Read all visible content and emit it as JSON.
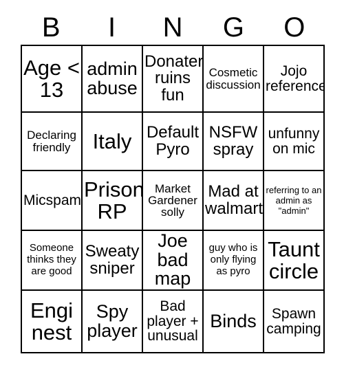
{
  "card": {
    "title": "BINGO",
    "header_letters": [
      "B",
      "I",
      "N",
      "G",
      "O"
    ],
    "columns": 5,
    "rows": 5,
    "border_color": "#000000",
    "background_color": "#ffffff",
    "text_color": "#000000",
    "cells": [
      [
        {
          "text": "Age < 13",
          "size": "fs-xxl"
        },
        {
          "text": "admin abuse",
          "size": "fs-xl"
        },
        {
          "text": "Donater ruins fun",
          "size": "fs-l"
        },
        {
          "text": "Cosmetic discussion",
          "size": "fs-s"
        },
        {
          "text": "Jojo reference",
          "size": "fs-m"
        }
      ],
      [
        {
          "text": "Declaring friendly",
          "size": "fs-s"
        },
        {
          "text": "Italy",
          "size": "fs-xxl"
        },
        {
          "text": "Default Pyro",
          "size": "fs-l"
        },
        {
          "text": "NSFW spray",
          "size": "fs-l"
        },
        {
          "text": "unfunny on mic",
          "size": "fs-m"
        }
      ],
      [
        {
          "text": "Micspam",
          "size": "fs-m"
        },
        {
          "text": "Prison RP",
          "size": "fs-xxl"
        },
        {
          "text": "Market Gardener solly",
          "size": "fs-s"
        },
        {
          "text": "Mad at walmart",
          "size": "fs-l"
        },
        {
          "text": "referring to an admin as \"admin\"",
          "size": "fs-xxs"
        }
      ],
      [
        {
          "text": "Someone thinks they are good",
          "size": "fs-xs"
        },
        {
          "text": "Sweaty sniper",
          "size": "fs-l"
        },
        {
          "text": "Joe bad map",
          "size": "fs-xl"
        },
        {
          "text": "guy who is only flying as pyro",
          "size": "fs-xs"
        },
        {
          "text": "Taunt circle",
          "size": "fs-xxl"
        }
      ],
      [
        {
          "text": "Engi nest",
          "size": "fs-xxl"
        },
        {
          "text": "Spy player",
          "size": "fs-xl"
        },
        {
          "text": "Bad player + unusual",
          "size": "fs-m"
        },
        {
          "text": "Binds",
          "size": "fs-xl"
        },
        {
          "text": "Spawn camping",
          "size": "fs-m"
        }
      ]
    ]
  }
}
